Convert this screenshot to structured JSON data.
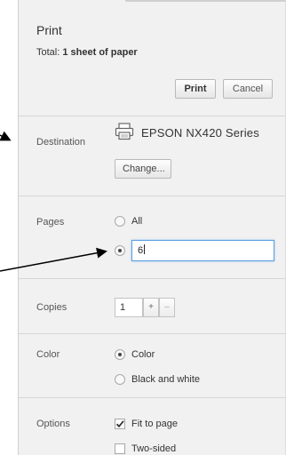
{
  "header": {
    "title": "Print",
    "total_label": "Total:",
    "total_value": "1 sheet of paper",
    "print_label": "Print",
    "cancel_label": "Cancel"
  },
  "destination": {
    "label": "Destination",
    "printer_name": "EPSON NX420 Series",
    "change_label": "Change...",
    "icon": "printer-icon"
  },
  "pages": {
    "label": "Pages",
    "option_all": "All",
    "selected": "custom",
    "custom_value": "6"
  },
  "copies": {
    "label": "Copies",
    "value": "1",
    "plus": "+",
    "minus": "–"
  },
  "color": {
    "label": "Color",
    "option_color": "Color",
    "option_bw": "Black and white",
    "selected": "color"
  },
  "options": {
    "label": "Options",
    "fit_to_page": "Fit to page",
    "fit_checked": true,
    "two_sided": "Two-sided",
    "two_sided_checked": false
  },
  "colors": {
    "panel_bg": "#f1f1f1",
    "focus_border": "#5d9ee0",
    "arrow": "#000000"
  }
}
